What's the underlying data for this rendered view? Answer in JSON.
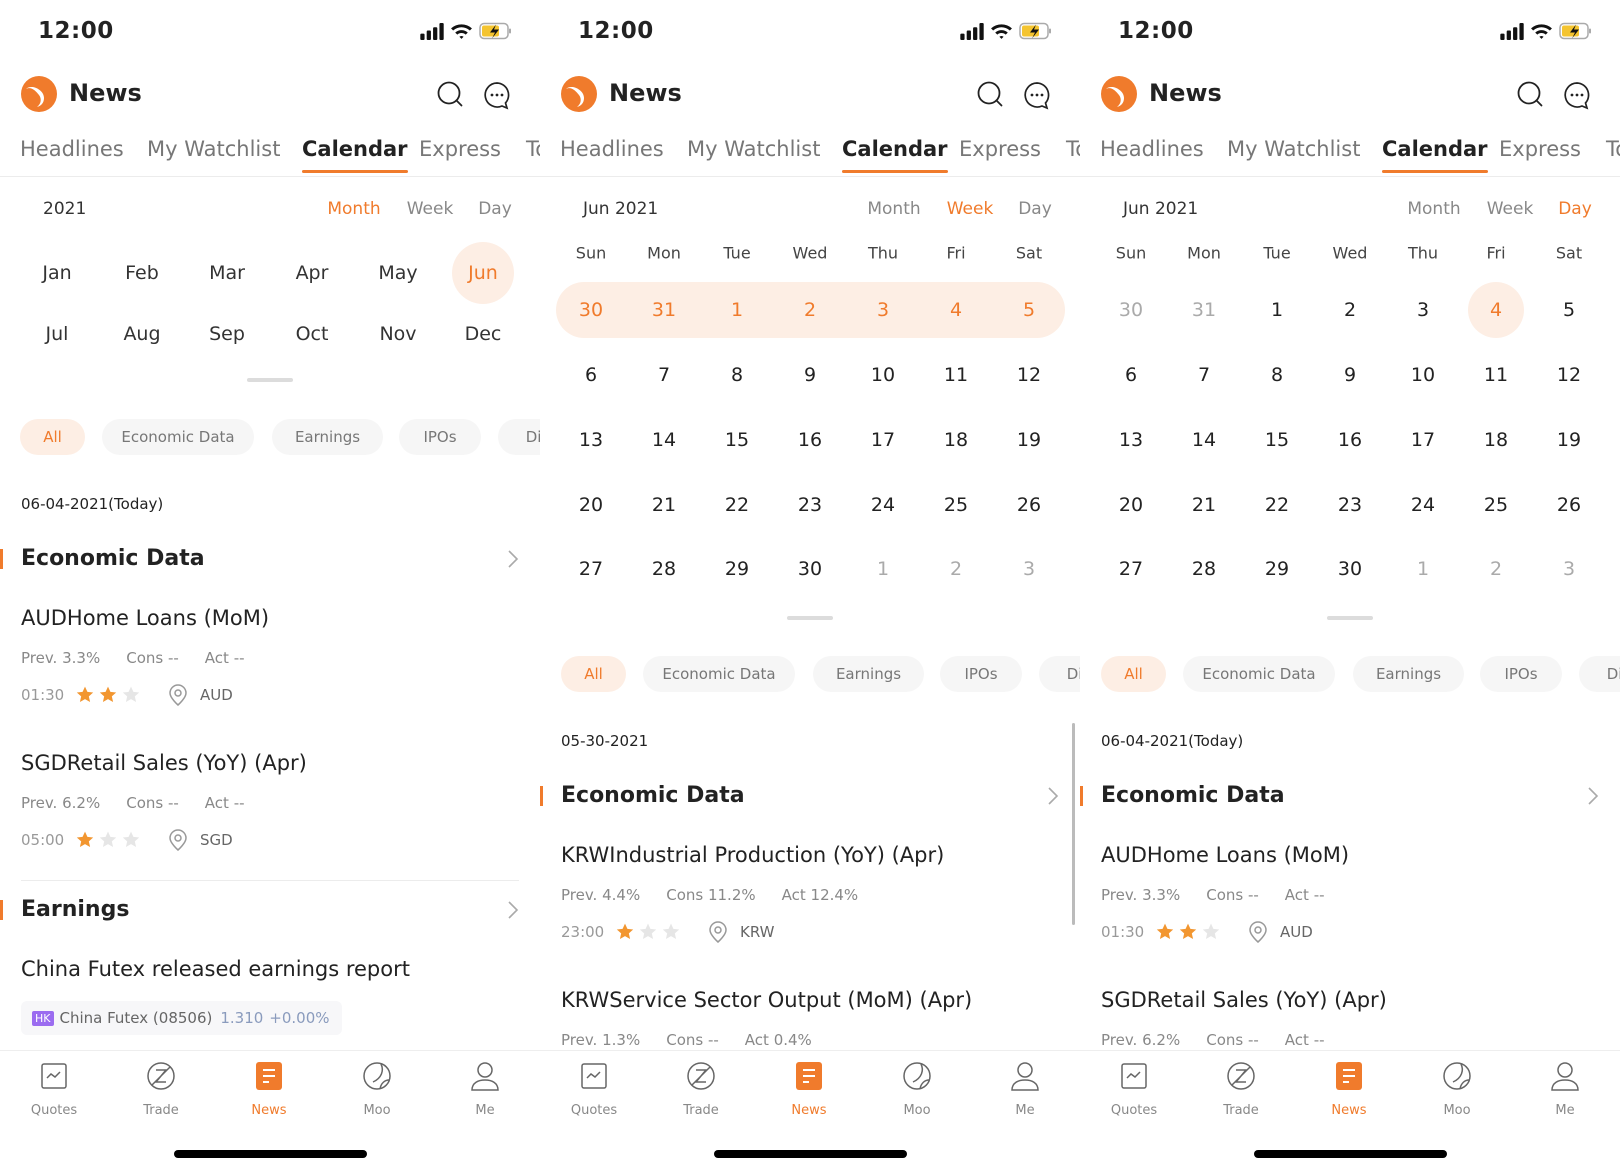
{
  "status": {
    "time": "12:00"
  },
  "header": {
    "title": "News"
  },
  "tabs": [
    "Headlines",
    "My Watchlist",
    "Calendar",
    "Express",
    "To"
  ],
  "active_tab": "Calendar",
  "view_options": [
    "Month",
    "Week",
    "Day"
  ],
  "filters": [
    "All",
    "Economic Data",
    "Earnings",
    "IPOs",
    "Div"
  ],
  "active_filter": "All",
  "weekdays": [
    "Sun",
    "Mon",
    "Tue",
    "Wed",
    "Thu",
    "Fri",
    "Sat"
  ],
  "panels": [
    {
      "view": "Month",
      "period_label": "2021",
      "months": [
        "Jan",
        "Feb",
        "Mar",
        "Apr",
        "May",
        "Jun",
        "Jul",
        "Aug",
        "Sep",
        "Oct",
        "Nov",
        "Dec"
      ],
      "active_month": "Jun",
      "date_label": "06-04-2021(Today)",
      "sections": [
        {
          "title": "Economic Data",
          "items": [
            {
              "title": "AUDHome Loans (MoM)",
              "prev": "Prev. 3.3%",
              "cons": "Cons --",
              "act": "Act --",
              "time": "01:30",
              "stars": 2,
              "currency": "AUD"
            },
            {
              "title": "SGDRetail Sales (YoY) (Apr)",
              "prev": "Prev. 6.2%",
              "cons": "Cons --",
              "act": "Act --",
              "time": "05:00",
              "stars": 1,
              "currency": "SGD"
            }
          ]
        },
        {
          "title": "Earnings",
          "earnings": [
            {
              "title": "China Futex  released earnings report",
              "market": "HK",
              "name": "China Futex (08506)",
              "price": "1.310",
              "change": "+0.00%"
            }
          ]
        }
      ]
    },
    {
      "view": "Week",
      "period_label": "Jun 2021",
      "selected_week": 0,
      "weeks": [
        [
          {
            "d": "30",
            "other": true
          },
          {
            "d": "31",
            "other": true
          },
          {
            "d": "1"
          },
          {
            "d": "2"
          },
          {
            "d": "3"
          },
          {
            "d": "4"
          },
          {
            "d": "5"
          }
        ],
        [
          {
            "d": "6"
          },
          {
            "d": "7"
          },
          {
            "d": "8"
          },
          {
            "d": "9"
          },
          {
            "d": "10"
          },
          {
            "d": "11"
          },
          {
            "d": "12"
          }
        ],
        [
          {
            "d": "13"
          },
          {
            "d": "14"
          },
          {
            "d": "15"
          },
          {
            "d": "16"
          },
          {
            "d": "17"
          },
          {
            "d": "18"
          },
          {
            "d": "19"
          }
        ],
        [
          {
            "d": "20"
          },
          {
            "d": "21"
          },
          {
            "d": "22"
          },
          {
            "d": "23"
          },
          {
            "d": "24"
          },
          {
            "d": "25"
          },
          {
            "d": "26"
          }
        ],
        [
          {
            "d": "27"
          },
          {
            "d": "28"
          },
          {
            "d": "29"
          },
          {
            "d": "30"
          },
          {
            "d": "1",
            "other": true
          },
          {
            "d": "2",
            "other": true
          },
          {
            "d": "3",
            "other": true
          }
        ]
      ],
      "date_label": "05-30-2021",
      "sections": [
        {
          "title": "Economic Data",
          "items": [
            {
              "title": "KRWIndustrial Production (YoY) (Apr)",
              "prev": "Prev. 4.4%",
              "cons": "Cons 11.2%",
              "act": "Act 12.4%",
              "time": "23:00",
              "stars": 1,
              "currency": "KRW"
            },
            {
              "title": "KRWService Sector Output (MoM) (Apr)",
              "prev": "Prev. 1.3%",
              "cons": "Cons --",
              "act": "Act 0.4%"
            }
          ]
        }
      ]
    },
    {
      "view": "Day",
      "period_label": "Jun 2021",
      "selected_day": "4",
      "weeks": [
        [
          {
            "d": "30",
            "other": true
          },
          {
            "d": "31",
            "other": true
          },
          {
            "d": "1"
          },
          {
            "d": "2"
          },
          {
            "d": "3"
          },
          {
            "d": "4"
          },
          {
            "d": "5"
          }
        ],
        [
          {
            "d": "6"
          },
          {
            "d": "7"
          },
          {
            "d": "8"
          },
          {
            "d": "9"
          },
          {
            "d": "10"
          },
          {
            "d": "11"
          },
          {
            "d": "12"
          }
        ],
        [
          {
            "d": "13"
          },
          {
            "d": "14"
          },
          {
            "d": "15"
          },
          {
            "d": "16"
          },
          {
            "d": "17"
          },
          {
            "d": "18"
          },
          {
            "d": "19"
          }
        ],
        [
          {
            "d": "20"
          },
          {
            "d": "21"
          },
          {
            "d": "22"
          },
          {
            "d": "23"
          },
          {
            "d": "24"
          },
          {
            "d": "25"
          },
          {
            "d": "26"
          }
        ],
        [
          {
            "d": "27"
          },
          {
            "d": "28"
          },
          {
            "d": "29"
          },
          {
            "d": "30"
          },
          {
            "d": "1",
            "other": true
          },
          {
            "d": "2",
            "other": true
          },
          {
            "d": "3",
            "other": true
          }
        ]
      ],
      "date_label": "06-04-2021(Today)",
      "sections": [
        {
          "title": "Economic Data",
          "items": [
            {
              "title": "AUDHome Loans (MoM)",
              "prev": "Prev. 3.3%",
              "cons": "Cons --",
              "act": "Act --",
              "time": "01:30",
              "stars": 2,
              "currency": "AUD"
            },
            {
              "title": "SGDRetail Sales (YoY) (Apr)",
              "prev": "Prev. 6.2%",
              "cons": "Cons --",
              "act": "Act --"
            }
          ]
        }
      ]
    }
  ],
  "bottom_nav": [
    {
      "label": "Quotes",
      "icon": "quotes-chart-icon"
    },
    {
      "label": "Trade",
      "icon": "trade-icon"
    },
    {
      "label": "News",
      "icon": "news-icon"
    },
    {
      "label": "Moo",
      "icon": "moo-icon"
    },
    {
      "label": "Me",
      "icon": "person-icon"
    }
  ],
  "active_nav": "News",
  "colors": {
    "accent": "#f07b2c",
    "accent_light": "#fdeee4",
    "star": "#f29630",
    "market_badge": "#9b6cf0"
  }
}
